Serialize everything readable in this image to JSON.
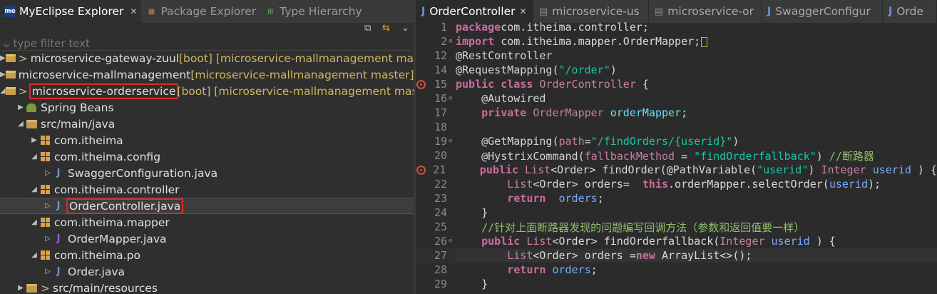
{
  "explorer": {
    "tabs": [
      {
        "label": "MyEclipse Explorer",
        "active": true,
        "icon": "myeclipse-icon"
      },
      {
        "label": "Package Explorer",
        "active": false,
        "icon": "package-explorer-icon"
      },
      {
        "label": "Type Hierarchy",
        "active": false,
        "icon": "type-hierarchy-icon"
      }
    ],
    "filter_placeholder": "type filter text",
    "tree": [
      {
        "indent": 0,
        "arrow": "▶",
        "icon": "project",
        "prefix": ">",
        "label": "microservice-gateway-zuul",
        "deco": " [boot] [microservice-mallmanagement mast"
      },
      {
        "indent": 0,
        "arrow": "▶",
        "icon": "project",
        "prefix": "",
        "label": "microservice-mallmanagement",
        "deco": " [microservice-mallmanagement master]"
      },
      {
        "indent": 0,
        "arrow": "◢",
        "icon": "project",
        "prefix": ">",
        "label": "microservice-orderservice",
        "deco": " [boot] [microservice-mallmanagement mast",
        "highlight": true
      },
      {
        "indent": 1,
        "arrow": "▶",
        "icon": "beans",
        "prefix": "",
        "label": "Spring Beans",
        "deco": ""
      },
      {
        "indent": 1,
        "arrow": "◢",
        "icon": "folder",
        "prefix": "",
        "label": "src/main/java",
        "deco": ""
      },
      {
        "indent": 2,
        "arrow": "▶",
        "icon": "package",
        "prefix": "",
        "label": "com.itheima",
        "deco": ""
      },
      {
        "indent": 2,
        "arrow": "◢",
        "icon": "package",
        "prefix": "",
        "label": "com.itheima.config",
        "deco": ""
      },
      {
        "indent": 3,
        "arrow": "▷",
        "icon": "java",
        "prefix": "",
        "label": "SwaggerConfiguration.java",
        "deco": ""
      },
      {
        "indent": 2,
        "arrow": "◢",
        "icon": "package",
        "prefix": "",
        "label": "com.itheima.controller",
        "deco": ""
      },
      {
        "indent": 3,
        "arrow": "▷",
        "icon": "java",
        "prefix": "",
        "label": "OrderController.java",
        "deco": "",
        "highlight": true,
        "selected": true
      },
      {
        "indent": 2,
        "arrow": "◢",
        "icon": "package",
        "prefix": "",
        "label": "com.itheima.mapper",
        "deco": ""
      },
      {
        "indent": 3,
        "arrow": "▷",
        "icon": "java-interface",
        "prefix": "",
        "label": "OrderMapper.java",
        "deco": ""
      },
      {
        "indent": 2,
        "arrow": "◢",
        "icon": "package",
        "prefix": "",
        "label": "com.itheima.po",
        "deco": ""
      },
      {
        "indent": 3,
        "arrow": "▷",
        "icon": "java",
        "prefix": "",
        "label": "Order.java",
        "deco": ""
      },
      {
        "indent": 1,
        "arrow": "▶",
        "icon": "folder",
        "prefix": ">",
        "label": "src/main/resources",
        "deco": ""
      }
    ]
  },
  "editor": {
    "tabs": [
      {
        "label": "OrderController",
        "active": true,
        "icon": "J"
      },
      {
        "label": "microservice-us",
        "active": false,
        "icon": "file"
      },
      {
        "label": "microservice-or",
        "active": false,
        "icon": "file"
      },
      {
        "label": "SwaggerConfigur",
        "active": false,
        "icon": "J"
      },
      {
        "label": "Orde",
        "active": false,
        "icon": "J"
      }
    ],
    "lines": [
      {
        "n": "1",
        "fold": "",
        "bp": false,
        "cur": false,
        "tokens": [
          [
            "k",
            "package"
          ],
          [
            "",
            "com.itheima.controller;"
          ]
        ]
      },
      {
        "n": "2",
        "fold": "⊕",
        "bp": false,
        "cur": false,
        "tokens": [
          [
            "k",
            "import"
          ],
          [
            "",
            " com.itheima.mapper.OrderMapper;"
          ],
          [
            "cm",
            ""
          ]
        ]
      },
      {
        "n": "12",
        "fold": "",
        "bp": false,
        "cur": false,
        "tokens": [
          [
            "an",
            "@RestController"
          ]
        ]
      },
      {
        "n": "14",
        "fold": "",
        "bp": false,
        "cur": false,
        "tokens": [
          [
            "an",
            "@RequestMapping("
          ],
          [
            "s",
            "\"/order\""
          ],
          [
            "an",
            ")"
          ]
        ]
      },
      {
        "n": "15",
        "fold": "",
        "bp": true,
        "cur": false,
        "tokens": [
          [
            "k",
            "public class "
          ],
          [
            "ty",
            "OrderController"
          ],
          [
            "",
            " {"
          ]
        ]
      },
      {
        "n": "16",
        "fold": "⊖",
        "bp": false,
        "cur": false,
        "tokens": [
          [
            "",
            "    "
          ],
          [
            "an",
            "@Autowired"
          ]
        ]
      },
      {
        "n": "17",
        "fold": "",
        "bp": false,
        "cur": false,
        "tokens": [
          [
            "",
            "    "
          ],
          [
            "k",
            "private "
          ],
          [
            "ty",
            "OrderMapper"
          ],
          [
            "",
            " "
          ],
          [
            "fld",
            "orderMapper"
          ],
          [
            "",
            ";"
          ]
        ]
      },
      {
        "n": "18",
        "fold": "",
        "bp": false,
        "cur": false,
        "tokens": [
          [
            "",
            ""
          ]
        ]
      },
      {
        "n": "19",
        "fold": "⊖",
        "bp": false,
        "cur": false,
        "tokens": [
          [
            "",
            "    "
          ],
          [
            "an",
            "@GetMapping("
          ],
          [
            "ty",
            "path"
          ],
          [
            "",
            "="
          ],
          [
            "s",
            "\"/findOrders/{userid}\""
          ],
          [
            "an",
            ")"
          ]
        ]
      },
      {
        "n": "20",
        "fold": "",
        "bp": false,
        "cur": false,
        "tokens": [
          [
            "",
            "    "
          ],
          [
            "an",
            "@HystrixCommand("
          ],
          [
            "ty",
            "fallbackMethod"
          ],
          [
            "",
            " = "
          ],
          [
            "s",
            "\"findOrderfallback\""
          ],
          [
            "an",
            ")"
          ],
          [
            "c",
            " //断路器"
          ]
        ]
      },
      {
        "n": "21",
        "fold": "",
        "bp": true,
        "cur": false,
        "tokens": [
          [
            "",
            "    "
          ],
          [
            "k",
            "public "
          ],
          [
            "ty",
            "List"
          ],
          [
            "",
            "<Order> findOrder(@PathVariable("
          ],
          [
            "s",
            "\"userid\""
          ],
          [
            "",
            ") "
          ],
          [
            "ty",
            "Integer"
          ],
          [
            "",
            " "
          ],
          [
            "v",
            "userid"
          ],
          [
            "",
            " ) {"
          ]
        ]
      },
      {
        "n": "22",
        "fold": "",
        "bp": false,
        "cur": false,
        "tokens": [
          [
            "",
            "        "
          ],
          [
            "ty",
            "List"
          ],
          [
            "",
            "<Order> orders=  "
          ],
          [
            "k",
            "this"
          ],
          [
            "",
            ".orderMapper.selectOrder("
          ],
          [
            "v",
            "userid"
          ],
          [
            "",
            ");"
          ]
        ]
      },
      {
        "n": "23",
        "fold": "",
        "bp": false,
        "cur": false,
        "tokens": [
          [
            "",
            "        "
          ],
          [
            "k",
            "return"
          ],
          [
            "",
            "  "
          ],
          [
            "v",
            "orders"
          ],
          [
            "",
            ";"
          ]
        ]
      },
      {
        "n": "24",
        "fold": "",
        "bp": false,
        "cur": false,
        "tokens": [
          [
            "",
            "    }"
          ]
        ]
      },
      {
        "n": "25",
        "fold": "",
        "bp": false,
        "cur": false,
        "tokens": [
          [
            "",
            "    "
          ],
          [
            "c",
            "//针对上面断路器发现的问题编写回调方法（参数和返回值要一样）"
          ]
        ]
      },
      {
        "n": "26",
        "fold": "⊖",
        "bp": false,
        "cur": false,
        "tokens": [
          [
            "",
            "    "
          ],
          [
            "k",
            "public "
          ],
          [
            "ty",
            "List"
          ],
          [
            "",
            "<Order> findOrderfallback("
          ],
          [
            "ty",
            "Integer"
          ],
          [
            "",
            " "
          ],
          [
            "v",
            "userid"
          ],
          [
            "",
            " ) {"
          ]
        ]
      },
      {
        "n": "27",
        "fold": "",
        "bp": false,
        "cur": true,
        "tokens": [
          [
            "",
            "        "
          ],
          [
            "ty",
            "List"
          ],
          [
            "",
            "<Order> orders ="
          ],
          [
            "k",
            "new "
          ],
          [
            "",
            "ArrayList<>();"
          ]
        ]
      },
      {
        "n": "28",
        "fold": "",
        "bp": false,
        "cur": false,
        "tokens": [
          [
            "",
            "        "
          ],
          [
            "k",
            "return "
          ],
          [
            "v",
            "orders"
          ],
          [
            "",
            ";"
          ]
        ]
      },
      {
        "n": "29",
        "fold": "",
        "bp": false,
        "cur": false,
        "tokens": [
          [
            "",
            "    }"
          ]
        ]
      }
    ]
  }
}
